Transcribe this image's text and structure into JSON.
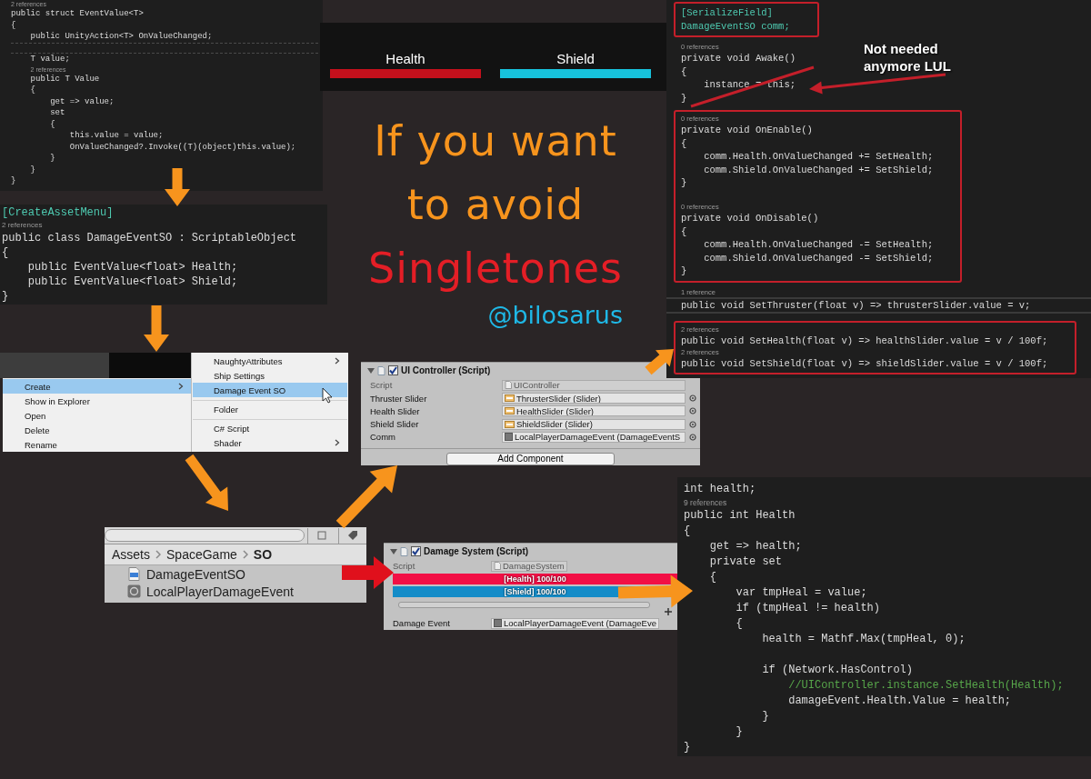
{
  "struct_code": {
    "lines": [
      {
        "kind": "ref",
        "text": "2 references"
      },
      {
        "kind": "code",
        "text": "public struct EventValue<T>"
      },
      {
        "kind": "code",
        "text": "{"
      },
      {
        "kind": "code",
        "text": "    public UnityAction<T> OnValueChanged;"
      },
      {
        "kind": "current-line"
      },
      {
        "kind": "code",
        "text": "    T value;"
      },
      {
        "kind": "ref",
        "text": "    2 references"
      },
      {
        "kind": "code",
        "text": "    public T Value"
      },
      {
        "kind": "code",
        "text": "    {"
      },
      {
        "kind": "code",
        "text": "        get => value;"
      },
      {
        "kind": "code",
        "text": "        set"
      },
      {
        "kind": "code",
        "text": "        {"
      },
      {
        "kind": "code",
        "text": "            this.value = value;"
      },
      {
        "kind": "code",
        "text": "            OnValueChanged?.Invoke((T)(object)this.value);"
      },
      {
        "kind": "code",
        "text": "        }"
      },
      {
        "kind": "code",
        "text": "    }"
      },
      {
        "kind": "code",
        "text": "}"
      }
    ]
  },
  "hud_bars": [
    {
      "label": "Health",
      "color": "#c4101c"
    },
    {
      "label": "Shield",
      "color": "#17c2dc"
    }
  ],
  "title_text": {
    "lines": [
      {
        "text": "If you want",
        "color": "#f7941d"
      },
      {
        "text": "to avoid",
        "color": "#f7941d"
      },
      {
        "text": "Singletones",
        "color": "#e41e26"
      }
    ],
    "handle": "@bilosarus"
  },
  "class_code": {
    "lines": [
      {
        "kind": "attr",
        "text": "[CreateAssetMenu]"
      },
      {
        "kind": "ref",
        "text": "2 references"
      },
      {
        "kind": "code",
        "text": "public class DamageEventSO : ScriptableObject"
      },
      {
        "kind": "code",
        "text": "{"
      },
      {
        "kind": "code",
        "text": "    public EventValue<float> Health;"
      },
      {
        "kind": "code",
        "text": "    public EventValue<float> Shield;"
      },
      {
        "kind": "code",
        "text": "}"
      }
    ]
  },
  "context_menu": {
    "items": [
      {
        "label": "Create",
        "selected": true,
        "submenu": true
      },
      {
        "label": "Show in Explorer",
        "selected": false,
        "submenu": false
      },
      {
        "label": "Open",
        "selected": false,
        "submenu": false
      },
      {
        "label": "Delete",
        "selected": false,
        "submenu": false
      },
      {
        "label": "Rename",
        "selected": false,
        "submenu": false
      }
    ],
    "submenu_items": [
      {
        "label": "NaughtyAttributes",
        "selected": false,
        "submenu": true,
        "separator_before": false
      },
      {
        "label": "Ship Settings",
        "selected": false,
        "submenu": false,
        "separator_before": false
      },
      {
        "label": "Damage Event SO",
        "selected": true,
        "submenu": false,
        "separator_before": false
      },
      {
        "label": "Folder",
        "selected": false,
        "submenu": false,
        "separator_before": true
      },
      {
        "label": "C# Script",
        "selected": false,
        "submenu": false,
        "separator_before": true
      },
      {
        "label": "Shader",
        "selected": false,
        "submenu": true,
        "separator_before": false
      }
    ]
  },
  "project_browser": {
    "breadcrumb": [
      "Assets",
      "SpaceGame",
      "SO"
    ],
    "items": [
      {
        "name": "DamageEventSO",
        "kind": "script"
      },
      {
        "name": "LocalPlayerDamageEvent",
        "kind": "asset"
      }
    ]
  },
  "ui_controller_inspector": {
    "title": "UI Controller (Script)",
    "enabled": true,
    "rows": [
      {
        "label": "Script",
        "value": "UIController",
        "kind": "script",
        "disabled": true
      },
      {
        "label": "Thruster Slider",
        "value": "ThrusterSlider (Slider)",
        "kind": "slider",
        "disabled": false
      },
      {
        "label": "Health Slider",
        "value": "HealthSlider (Slider)",
        "kind": "slider",
        "disabled": false
      },
      {
        "label": "Shield Slider",
        "value": "ShieldSlider (Slider)",
        "kind": "slider",
        "disabled": false
      },
      {
        "label": "Comm",
        "value": "LocalPlayerDamageEvent (DamageEventS",
        "kind": "asset",
        "disabled": false
      }
    ],
    "button": "Add Component"
  },
  "damage_system_inspector": {
    "title": "Damage System (Script)",
    "enabled": true,
    "rows": [
      {
        "label": "Script",
        "value": "DamageSystem",
        "kind": "script",
        "disabled": true
      }
    ],
    "bars": [
      {
        "label": "[Health] 100/100",
        "color": "#f20f45",
        "level": 1
      },
      {
        "label": "[Shield] 100/100",
        "color": "#148cc8",
        "level": 1
      }
    ],
    "fields": [
      {
        "label": "Damage Event",
        "value": "LocalPlayerDamageEvent (DamageEve",
        "kind": "asset",
        "disabled": false
      }
    ]
  },
  "controller_code": {
    "sections": [
      {
        "kind": "box",
        "lines": [
          {
            "kind": "attr",
            "text": "[SerializeField]"
          },
          {
            "kind": "attr",
            "text": "DamageEventSO comm;"
          }
        ]
      },
      {
        "kind": "plain",
        "lines": [
          {
            "kind": "ref",
            "text": "0 references"
          },
          {
            "kind": "code",
            "text": "private void Awake()"
          },
          {
            "kind": "code",
            "text": "{"
          },
          {
            "kind": "code",
            "text": "    instance = this;"
          },
          {
            "kind": "code",
            "text": "}"
          }
        ]
      },
      {
        "kind": "box",
        "lines": [
          {
            "kind": "ref",
            "text": "0 references"
          },
          {
            "kind": "code",
            "text": "private void OnEnable()"
          },
          {
            "kind": "code",
            "text": "{"
          },
          {
            "kind": "code",
            "text": "    comm.Health.OnValueChanged += SetHealth;"
          },
          {
            "kind": "code",
            "text": "    comm.Shield.OnValueChanged += SetShield;"
          },
          {
            "kind": "code",
            "text": "}"
          },
          {
            "kind": "gap"
          },
          {
            "kind": "ref",
            "text": "0 references"
          },
          {
            "kind": "code",
            "text": "private void OnDisable()"
          },
          {
            "kind": "code",
            "text": "{"
          },
          {
            "kind": "code",
            "text": "    comm.Health.OnValueChanged -= SetHealth;"
          },
          {
            "kind": "code",
            "text": "    comm.Shield.OnValueChanged -= SetShield;"
          },
          {
            "kind": "code",
            "text": "}"
          }
        ]
      },
      {
        "kind": "rules",
        "lines": [
          {
            "kind": "ref",
            "text": "1 reference"
          },
          {
            "kind": "code",
            "text": "public void SetThruster(float v) => thrusterSlider.value = v;"
          }
        ]
      },
      {
        "kind": "box",
        "lines": [
          {
            "kind": "ref",
            "text": "2 references"
          },
          {
            "kind": "code",
            "text": "public void SetHealth(float v) => healthSlider.value = v / 100f;"
          },
          {
            "kind": "ref",
            "text": "2 references"
          },
          {
            "kind": "code",
            "text": "public void SetShield(float v) => shieldSlider.value = v / 100f;"
          }
        ]
      }
    ]
  },
  "annotation": {
    "text": "Not needed anymore LUL"
  },
  "health_property_code": {
    "lines": [
      {
        "kind": "code",
        "text": "int health;"
      },
      {
        "kind": "ref",
        "text": "9 references"
      },
      {
        "kind": "code",
        "text": "public int Health"
      },
      {
        "kind": "code",
        "text": "{"
      },
      {
        "kind": "code",
        "text": "    get => health;"
      },
      {
        "kind": "code",
        "text": "    private set"
      },
      {
        "kind": "code",
        "text": "    {"
      },
      {
        "kind": "code",
        "text": "        var tmpHeal = value;"
      },
      {
        "kind": "code",
        "text": "        if (tmpHeal != health)"
      },
      {
        "kind": "code",
        "text": "        {"
      },
      {
        "kind": "code",
        "text": "            health = Mathf.Max(tmpHeal, 0);"
      },
      {
        "kind": "gap"
      },
      {
        "kind": "code",
        "text": "            if (Network.HasControl)"
      },
      {
        "kind": "comment",
        "text": "                //UIController.instance.SetHealth(Health);"
      },
      {
        "kind": "code",
        "text": "                damageEvent.Health.Value = health;"
      },
      {
        "kind": "code",
        "text": "            }"
      },
      {
        "kind": "code",
        "text": "        }"
      },
      {
        "kind": "code",
        "text": "}"
      }
    ]
  }
}
